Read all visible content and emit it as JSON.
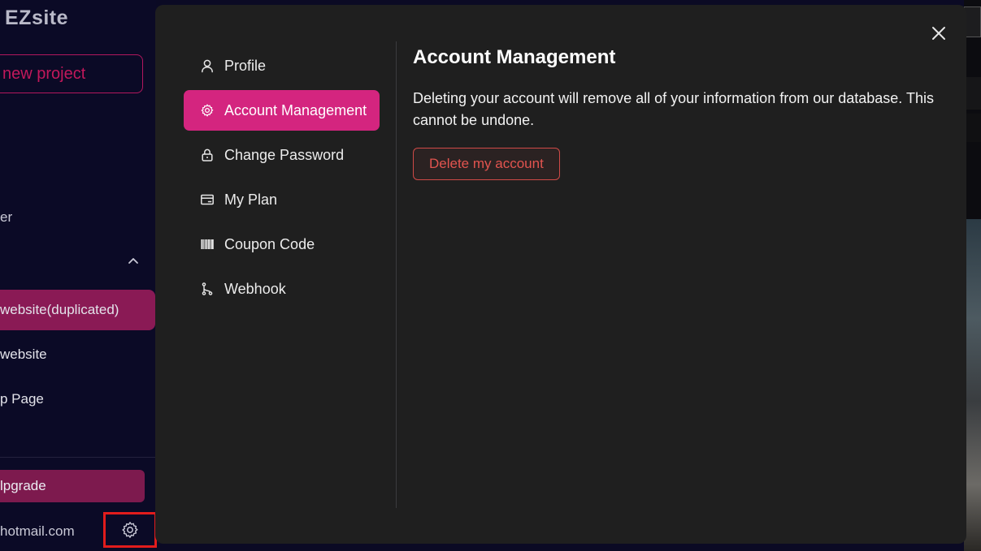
{
  "app": {
    "brand": "EZsite",
    "new_project_label": "new project",
    "sidebar_partial_text": "er",
    "projects": [
      {
        "label": "website(duplicated)",
        "active": true
      },
      {
        "label": "website",
        "active": false
      },
      {
        "label": "p Page",
        "active": false
      }
    ],
    "upgrade_label": "lpgrade",
    "user_email": "hotmail.com"
  },
  "modal": {
    "nav": [
      {
        "label": "Profile",
        "icon": "user-icon",
        "active": false
      },
      {
        "label": "Account Management",
        "icon": "gear-icon",
        "active": true
      },
      {
        "label": "Change Password",
        "icon": "lock-icon",
        "active": false
      },
      {
        "label": "My Plan",
        "icon": "card-icon",
        "active": false
      },
      {
        "label": "Coupon Code",
        "icon": "barcode-icon",
        "active": false
      },
      {
        "label": "Webhook",
        "icon": "webhook-icon",
        "active": false
      }
    ],
    "content": {
      "title": "Account Management",
      "description": "Deleting your account will remove all of your information from our database. This cannot be undone.",
      "delete_label": "Delete my account"
    }
  },
  "colors": {
    "accent": "#d4257f",
    "danger": "#e2544f",
    "modal_bg": "#1f1f1f",
    "app_bg": "#0b0a24"
  }
}
